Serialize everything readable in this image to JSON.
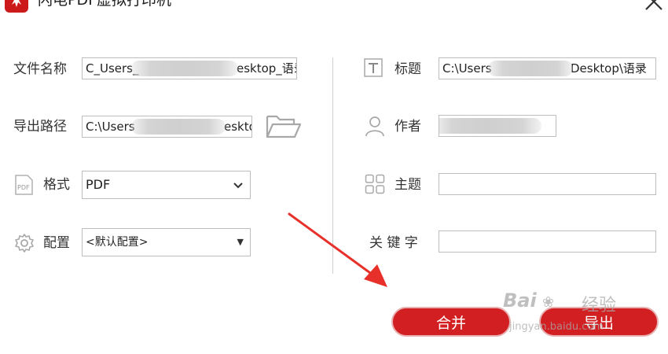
{
  "window": {
    "title": "闪电PDF虚拟打印机"
  },
  "left": {
    "filename_label": "文件名称",
    "filename_value_start": "C_Users_",
    "filename_value_end": "esktop_语录.p",
    "export_path_label": "导出路径",
    "export_path_value_start": "C:\\Users",
    "export_path_value_end": "eskto",
    "format_label": "格式",
    "format_value": "PDF",
    "config_label": "配置",
    "config_value": "<默认配置>"
  },
  "right": {
    "title_label": "标题",
    "title_value_start": "C:\\Users",
    "title_value_end": "Desktop\\语录",
    "author_label": "作者",
    "author_value": "",
    "subject_label": "主题",
    "subject_value": "",
    "keywords_label": "关 键 字",
    "keywords_value": ""
  },
  "buttons": {
    "merge": "合并",
    "export": "导出"
  },
  "watermark": {
    "brand": "Bai",
    "brand_cn": "经验",
    "url": "jingyan.baidu.com"
  },
  "colors": {
    "accent": "#d11f22",
    "arrow": "#e8302a"
  },
  "icons": {
    "app": "app-logo-icon",
    "close": "close-icon",
    "folder": "folder-icon",
    "pdf": "pdf-file-icon",
    "gear": "gear-icon",
    "text": "text-icon",
    "user": "user-icon",
    "grid": "grid-icon"
  }
}
